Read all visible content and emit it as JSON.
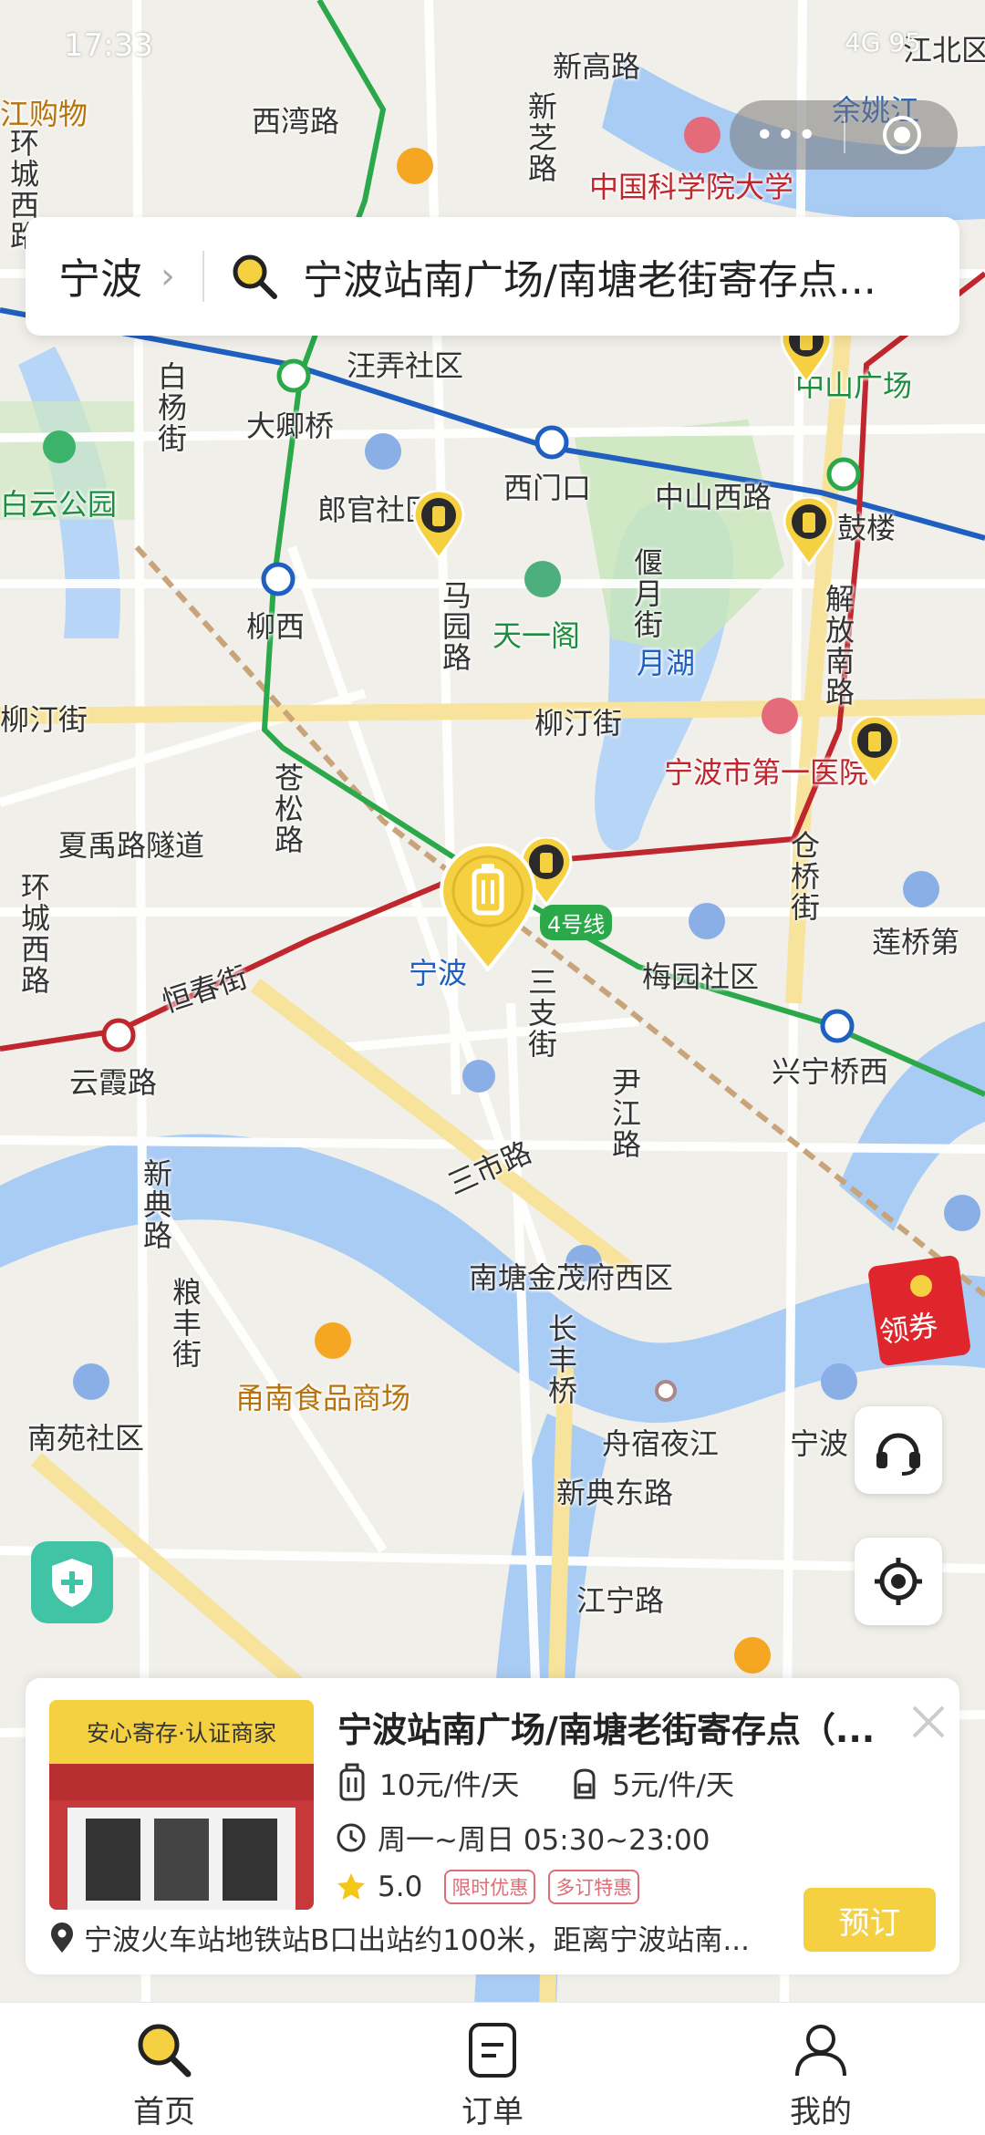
{
  "status_bar": {
    "time": "17:33",
    "right_text": "4G 95"
  },
  "search": {
    "city": "宁波",
    "query": "宁波站南广场/南塘老街寄存点..."
  },
  "map_labels": [
    {
      "text": "西湾路",
      "style": ""
    },
    {
      "text": "新高路",
      "style": ""
    },
    {
      "text": "新芝路",
      "style": ""
    },
    {
      "text": "中国科学院大学",
      "style": "red"
    },
    {
      "text": "余姚江",
      "style": "blue"
    },
    {
      "text": "江北区",
      "style": ""
    },
    {
      "text": "江购物",
      "style": "orange"
    },
    {
      "text": "环城西路",
      "style": ""
    },
    {
      "text": "汪弄社区",
      "style": ""
    },
    {
      "text": "大卿桥",
      "style": ""
    },
    {
      "text": "白杨街",
      "style": ""
    },
    {
      "text": "白云公园",
      "style": "green"
    },
    {
      "text": "郎官社区",
      "style": ""
    },
    {
      "text": "西门口",
      "style": ""
    },
    {
      "text": "中山西路",
      "style": ""
    },
    {
      "text": "中山广场",
      "style": "green"
    },
    {
      "text": "鼓楼",
      "style": ""
    },
    {
      "text": "柳西",
      "style": ""
    },
    {
      "text": "马园路",
      "style": ""
    },
    {
      "text": "天一阁",
      "style": "green"
    },
    {
      "text": "偃月街",
      "style": ""
    },
    {
      "text": "月湖",
      "style": "blue"
    },
    {
      "text": "解放南路",
      "style": ""
    },
    {
      "text": "柳汀街",
      "style": ""
    },
    {
      "text": "柳汀街",
      "style": ""
    },
    {
      "text": "宁波市第一医院",
      "style": "red"
    },
    {
      "text": "苍松路",
      "style": ""
    },
    {
      "text": "夏禹路隧道",
      "style": ""
    },
    {
      "text": "环城西路",
      "style": ""
    },
    {
      "text": "仓桥街",
      "style": ""
    },
    {
      "text": "莲桥第",
      "style": ""
    },
    {
      "text": "4号线",
      "style": ""
    },
    {
      "text": "梅园社区",
      "style": ""
    },
    {
      "text": "宁波",
      "style": "blue"
    },
    {
      "text": "恒春街",
      "style": ""
    },
    {
      "text": "三支街",
      "style": ""
    },
    {
      "text": "云霞路",
      "style": ""
    },
    {
      "text": "兴宁桥西",
      "style": ""
    },
    {
      "text": "尹江路",
      "style": ""
    },
    {
      "text": "三市路",
      "style": ""
    },
    {
      "text": "新典路",
      "style": ""
    },
    {
      "text": "南塘金茂府西区",
      "style": ""
    },
    {
      "text": "粮丰街",
      "style": ""
    },
    {
      "text": "甬南食品商场",
      "style": "orange"
    },
    {
      "text": "长丰桥",
      "style": ""
    },
    {
      "text": "南苑社区",
      "style": ""
    },
    {
      "text": "舟宿夜江",
      "style": ""
    },
    {
      "text": "宁波",
      "style": ""
    },
    {
      "text": "新典东路",
      "style": ""
    },
    {
      "text": "江宁路",
      "style": ""
    }
  ],
  "coupon_label": "领券",
  "store": {
    "tag": "安心寄存·认证商家",
    "title": "宁波站南广场/南塘老街寄存点（...",
    "price_large": "10元/件/天",
    "price_small": "5元/件/天",
    "hours": "周一~周日 05:30~23:00",
    "rating": "5.0",
    "tags": [
      "限时优惠",
      "多订特惠"
    ],
    "address": "宁波火车站地铁站B口出站约100米，距离宁波站南...",
    "book_label": "预订"
  },
  "tabs": [
    {
      "label": "首页",
      "icon": "search-icon"
    },
    {
      "label": "订单",
      "icon": "order-icon"
    },
    {
      "label": "我的",
      "icon": "profile-icon"
    }
  ],
  "colors": {
    "accent": "#f5d142",
    "metro_blue": "#1f5fbf",
    "metro_green": "#2aa84a",
    "metro_red": "#c0262d"
  }
}
